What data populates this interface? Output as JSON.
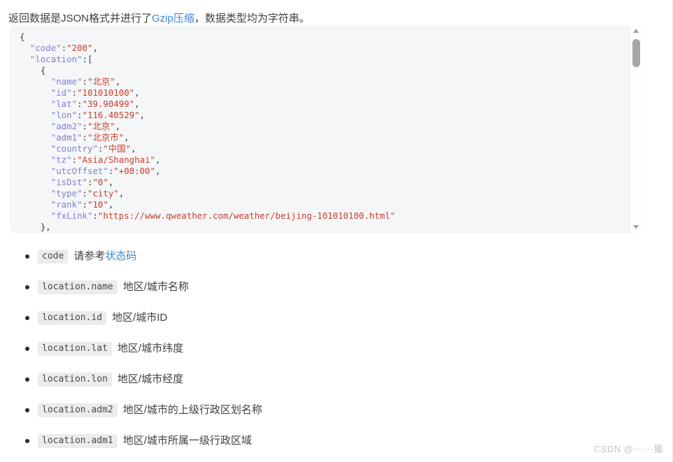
{
  "intro": {
    "before_link": "返回数据是JSON格式并进行了",
    "link_label": "Gzip压缩",
    "after_link": "，数据类型均为字符串。"
  },
  "code_block": {
    "language": "json",
    "scrollbar": {
      "up_arrow_icon": "triangle-up-icon",
      "down_arrow_icon": "triangle-down-icon",
      "thumb_position_percent": 7
    },
    "lines": [
      [
        {
          "t": "punct",
          "v": "{"
        }
      ],
      [
        {
          "t": "punct",
          "v": "  "
        },
        {
          "t": "key",
          "v": "\"code\""
        },
        {
          "t": "punct",
          "v": ":"
        },
        {
          "t": "str",
          "v": "\"200\""
        },
        {
          "t": "punct",
          "v": ","
        }
      ],
      [
        {
          "t": "punct",
          "v": "  "
        },
        {
          "t": "key",
          "v": "\"location\""
        },
        {
          "t": "punct",
          "v": ":["
        }
      ],
      [
        {
          "t": "punct",
          "v": "    {"
        }
      ],
      [
        {
          "t": "punct",
          "v": "      "
        },
        {
          "t": "key",
          "v": "\"name\""
        },
        {
          "t": "punct",
          "v": ":"
        },
        {
          "t": "str",
          "v": "\"北京\""
        },
        {
          "t": "punct",
          "v": ","
        }
      ],
      [
        {
          "t": "punct",
          "v": "      "
        },
        {
          "t": "key",
          "v": "\"id\""
        },
        {
          "t": "punct",
          "v": ":"
        },
        {
          "t": "str",
          "v": "\"101010100\""
        },
        {
          "t": "punct",
          "v": ","
        }
      ],
      [
        {
          "t": "punct",
          "v": "      "
        },
        {
          "t": "key",
          "v": "\"lat\""
        },
        {
          "t": "punct",
          "v": ":"
        },
        {
          "t": "str",
          "v": "\"39.90499\""
        },
        {
          "t": "punct",
          "v": ","
        }
      ],
      [
        {
          "t": "punct",
          "v": "      "
        },
        {
          "t": "key",
          "v": "\"lon\""
        },
        {
          "t": "punct",
          "v": ":"
        },
        {
          "t": "str",
          "v": "\"116.40529\""
        },
        {
          "t": "punct",
          "v": ","
        }
      ],
      [
        {
          "t": "punct",
          "v": "      "
        },
        {
          "t": "key",
          "v": "\"adm2\""
        },
        {
          "t": "punct",
          "v": ":"
        },
        {
          "t": "str",
          "v": "\"北京\""
        },
        {
          "t": "punct",
          "v": ","
        }
      ],
      [
        {
          "t": "punct",
          "v": "      "
        },
        {
          "t": "key",
          "v": "\"adm1\""
        },
        {
          "t": "punct",
          "v": ":"
        },
        {
          "t": "str",
          "v": "\"北京市\""
        },
        {
          "t": "punct",
          "v": ","
        }
      ],
      [
        {
          "t": "punct",
          "v": "      "
        },
        {
          "t": "key",
          "v": "\"country\""
        },
        {
          "t": "punct",
          "v": ":"
        },
        {
          "t": "str",
          "v": "\"中国\""
        },
        {
          "t": "punct",
          "v": ","
        }
      ],
      [
        {
          "t": "punct",
          "v": "      "
        },
        {
          "t": "key",
          "v": "\"tz\""
        },
        {
          "t": "punct",
          "v": ":"
        },
        {
          "t": "str",
          "v": "\"Asia/Shanghai\""
        },
        {
          "t": "punct",
          "v": ","
        }
      ],
      [
        {
          "t": "punct",
          "v": "      "
        },
        {
          "t": "key",
          "v": "\"utcOffset\""
        },
        {
          "t": "punct",
          "v": ":"
        },
        {
          "t": "str",
          "v": "\"+08:00\""
        },
        {
          "t": "punct",
          "v": ","
        }
      ],
      [
        {
          "t": "punct",
          "v": "      "
        },
        {
          "t": "key",
          "v": "\"isDst\""
        },
        {
          "t": "punct",
          "v": ":"
        },
        {
          "t": "str",
          "v": "\"0\""
        },
        {
          "t": "punct",
          "v": ","
        }
      ],
      [
        {
          "t": "punct",
          "v": "      "
        },
        {
          "t": "key",
          "v": "\"type\""
        },
        {
          "t": "punct",
          "v": ":"
        },
        {
          "t": "str",
          "v": "\"city\""
        },
        {
          "t": "punct",
          "v": ","
        }
      ],
      [
        {
          "t": "punct",
          "v": "      "
        },
        {
          "t": "key",
          "v": "\"rank\""
        },
        {
          "t": "punct",
          "v": ":"
        },
        {
          "t": "str",
          "v": "\"10\""
        },
        {
          "t": "punct",
          "v": ","
        }
      ],
      [
        {
          "t": "punct",
          "v": "      "
        },
        {
          "t": "key",
          "v": "\"fxLink\""
        },
        {
          "t": "punct",
          "v": ":"
        },
        {
          "t": "str",
          "v": "\"https://www.qweather.com/weather/beijing-101010100.html\""
        }
      ],
      [
        {
          "t": "punct",
          "v": "    },"
        }
      ]
    ]
  },
  "fields": [
    {
      "code": "code",
      "desc_before": "请参考",
      "desc_link": "状态码",
      "desc_after": ""
    },
    {
      "code": "location.name",
      "desc_before": "地区/城市名称",
      "desc_link": "",
      "desc_after": ""
    },
    {
      "code": "location.id",
      "desc_before": "地区/城市ID",
      "desc_link": "",
      "desc_after": ""
    },
    {
      "code": "location.lat",
      "desc_before": "地区/城市纬度",
      "desc_link": "",
      "desc_after": ""
    },
    {
      "code": "location.lon",
      "desc_before": "地区/城市经度",
      "desc_link": "",
      "desc_after": ""
    },
    {
      "code": "location.adm2",
      "desc_before": "地区/城市的上级行政区划名称",
      "desc_link": "",
      "desc_after": ""
    },
    {
      "code": "location.adm1",
      "desc_before": "地区/城市所属一级行政区域",
      "desc_link": "",
      "desc_after": ""
    }
  ],
  "watermark": {
    "text": "CSDN @······獾"
  },
  "colors": {
    "link": "#3f84d2",
    "code_bg": "#f5f6f7",
    "inline_code_bg": "#ececec",
    "json_key": "#8080d8",
    "json_string": "#c8402e",
    "scrollbar_thumb": "#a6a6a6"
  }
}
